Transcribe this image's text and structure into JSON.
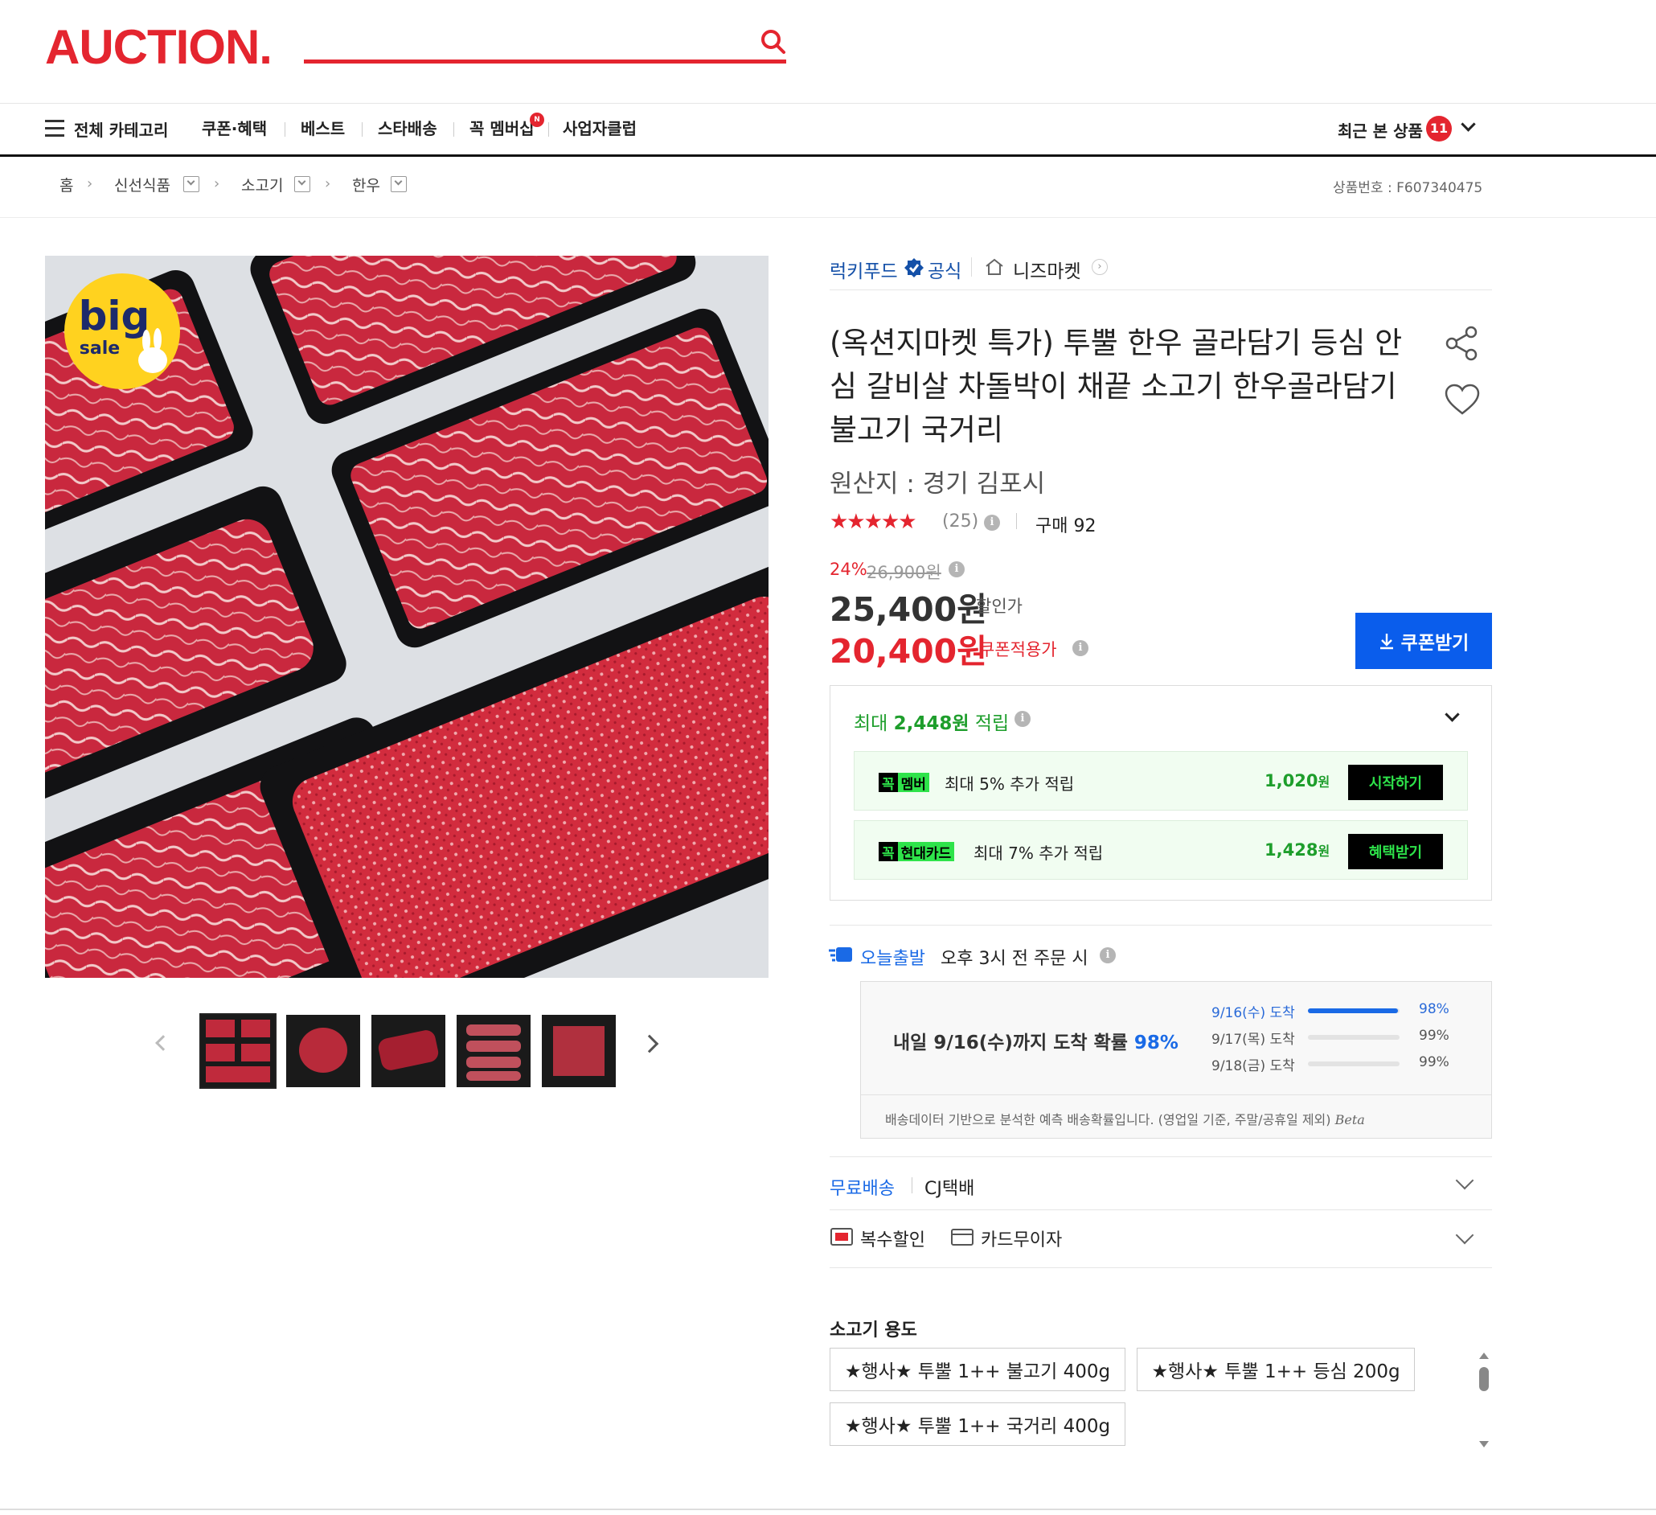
{
  "header": {
    "logo": "AUCTION."
  },
  "nav": {
    "all_categories": "전체 카테고리",
    "items": [
      "쿠폰·혜택",
      "베스트",
      "스타배송",
      "꼭 멤버십",
      "사업자클럽"
    ],
    "member_badge": "N",
    "recent_label": "최근 본 상품",
    "recent_count": "11"
  },
  "breadcrumb": {
    "items": [
      "홈",
      "신선식품",
      "소고기",
      "한우"
    ],
    "product_no": "상품번호 : F607340475"
  },
  "image": {
    "badge_big": "big",
    "badge_sale": "sale"
  },
  "seller": {
    "name": "럭키푸드",
    "official": "공식",
    "store": "니즈마켓"
  },
  "product": {
    "title": "(옥션지마켓 특가) 투뿔 한우 골라담기 등심 안심 갈비살 차돌박이 채끝 소고기 한우골라담기 불고기 국거리",
    "origin": "원산지 : 경기 김포시",
    "stars": "★★★★★",
    "rating": 4.5,
    "review_count": "(25)",
    "purchase": "구매 92"
  },
  "price": {
    "discount_rate": "24%",
    "original": "26,900원",
    "sale_price": "25,400원",
    "sale_label": "할인가",
    "coupon_price": "20,400원",
    "coupon_label": "쿠폰적용가",
    "coupon_button": "쿠폰받기"
  },
  "reward": {
    "prefix": "최대",
    "amount": "2,448원",
    "suffix": "적립",
    "rows": [
      {
        "badge_a": "꼭",
        "badge_b": "멤버",
        "text": "최대 5% 추가 적립",
        "amount": "1,020",
        "unit": "원",
        "button": "시작하기"
      },
      {
        "badge_a": "꼭",
        "badge_b": "현대카드",
        "text": "최대 7% 추가 적립",
        "amount": "1,428",
        "unit": "원",
        "button": "혜택받기"
      }
    ]
  },
  "shipping": {
    "today_label": "오늘출발",
    "today_text": "오후 3시 전 주문 시",
    "main_text": "내일 9/16(수)까지 도착 확률",
    "main_pct": "98%",
    "rows": [
      {
        "label": "9/16(수) 도착",
        "pct": "98%",
        "fill": 0.98
      },
      {
        "label": "9/17(목) 도착",
        "pct": "99%",
        "fill": 0.0
      },
      {
        "label": "9/18(금) 도착",
        "pct": "99%",
        "fill": 0.0
      }
    ],
    "note": "배송데이터 기반으로 분석한 예측 배송확률입니다. (영업일 기준, 주말/공휴일 제외)",
    "beta": "Beta",
    "free_label": "무료배송",
    "carrier": "CJ택배",
    "multi_discount": "복수할인",
    "card_installment": "카드무이자"
  },
  "options": {
    "title": "소고기 용도",
    "items": [
      "★행사★ 투뿔 1++ 불고기 400g",
      "★행사★ 투뿔 1++ 등심 200g",
      "★행사★ 투뿔 1++ 국거리 400g"
    ]
  },
  "colors": {
    "brand_red": "#e4252f",
    "link_blue": "#1450a8",
    "coupon_blue": "#0a5dec",
    "reward_green": "#1e9e2c"
  }
}
